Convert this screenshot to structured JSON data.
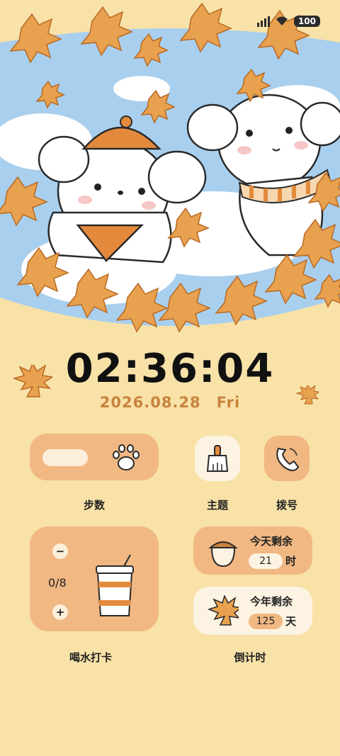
{
  "status_bar": {
    "battery": "100"
  },
  "clock": {
    "time": "02:36:04"
  },
  "date": {
    "date": "2026.08.28",
    "weekday": "Fri"
  },
  "widgets": {
    "steps_label": "步数",
    "theme_label": "主题",
    "dial_label": "拨号",
    "water": {
      "label": "喝水打卡",
      "count": "0/8",
      "minus": "−",
      "plus": "+"
    },
    "countdown": {
      "label": "倒计时",
      "today_title": "今天剩余",
      "today_value": "21",
      "today_unit": "时",
      "year_title": "今年剩余",
      "year_value": "125",
      "year_unit": "天"
    }
  },
  "colors": {
    "background": "#f8e2a8",
    "accent": "#f1b883",
    "date": "#c9833e"
  }
}
